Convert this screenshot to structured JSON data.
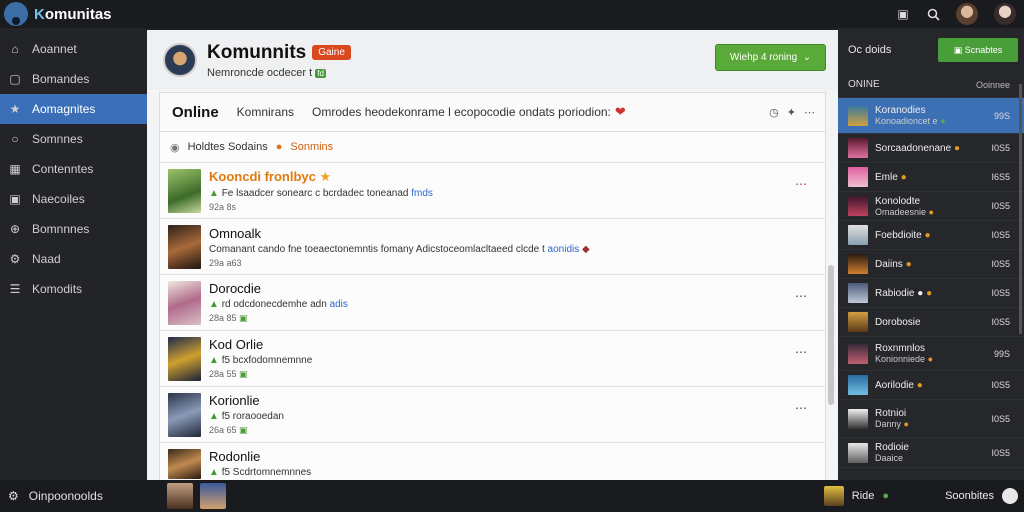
{
  "app": {
    "brand_prefix": "K",
    "brand_rest": "omunitas"
  },
  "colors": {
    "accent": "#3a6fb8",
    "join_green": "#5aaa3a",
    "badge_red": "#d9481f",
    "highlight_orange": "#e07a10"
  },
  "topbar": {
    "icons": [
      "window-icon",
      "search-icon"
    ]
  },
  "sidebar": {
    "items": [
      {
        "label": "Aoannet",
        "icon": "home-icon",
        "active": false
      },
      {
        "label": "Bomandes",
        "icon": "box-icon",
        "active": false
      },
      {
        "label": "Aomagnites",
        "icon": "star-icon",
        "active": true
      },
      {
        "label": "Somnnes",
        "icon": "chat-icon",
        "active": false
      },
      {
        "label": "Contenntes",
        "icon": "grid-icon",
        "active": false
      },
      {
        "label": "Naecoiles",
        "icon": "bookmark-icon",
        "active": false
      },
      {
        "label": "Bomnnnes",
        "icon": "globe-icon",
        "active": false
      },
      {
        "label": "Naad",
        "icon": "gear-icon",
        "active": false
      },
      {
        "label": "Komodits",
        "icon": "list-icon",
        "active": false
      }
    ]
  },
  "group": {
    "name": "Komunnits",
    "badge": "Gaine",
    "subtitle": "Nemroncde ocdecer t",
    "subtitle_tag": "fd",
    "join_label": "Wiehp 4 roning"
  },
  "tabs": {
    "active": "Online",
    "second": "Komnirans",
    "description": "Omrodes heodekonrame l ecopocodie ondats poriodion:"
  },
  "filters": {
    "left": "Holdtes Sodains",
    "right": "Sonmins"
  },
  "posts": [
    {
      "title": "Kooncdi fronlbyc",
      "line": "Fe lsaadcer sonearc c bcrdadec toneanad",
      "link": "fmds",
      "meta": "92a 8s"
    },
    {
      "title": "Omnoalk",
      "line": "Comanant cando fne toeaectonemntis fomany Adicstoceomlacltaeed clcde t",
      "link": "aonidis",
      "meta": "29a a63"
    },
    {
      "title": "Dorocdie",
      "line": "rd odcdonecdemhe adn",
      "link": "adis",
      "meta": "28a 85"
    },
    {
      "title": "Kod Orlie",
      "line": "f5 bcxfodomnemnne",
      "link": "",
      "meta": "28a 55"
    },
    {
      "title": "Korionlie",
      "line": "f5 roraooedan",
      "link": "",
      "meta": "26a 65"
    },
    {
      "title": "Rodonlie",
      "line": "f5 Scdrtomnemnnes",
      "link": "",
      "meta": ""
    }
  ],
  "right_panel": {
    "title": "Oc doids",
    "button": "Scnabtes",
    "section": "ONINE",
    "section_right": "Ooinnee",
    "items": [
      {
        "name": "Koranodies",
        "sub": "Konoadioncet e",
        "count": "99S"
      },
      {
        "name": "Sorcaadonenane",
        "sub": "",
        "count": "I0S5"
      },
      {
        "name": "Emle",
        "sub": "",
        "count": "I6S5"
      },
      {
        "name": "Konolodte",
        "sub": "Omadeesnie",
        "count": "I0S5"
      },
      {
        "name": "Foebdioite",
        "sub": "",
        "count": "I0S5"
      },
      {
        "name": "Daiins",
        "sub": "",
        "count": "I0S5"
      },
      {
        "name": "Rabiodie",
        "sub": "",
        "count": "I0S5"
      },
      {
        "name": "Dorobosie",
        "sub": "",
        "count": "I0S5"
      },
      {
        "name": "Roxnmnlos",
        "sub": "Konionniede",
        "count": "99S"
      },
      {
        "name": "Aorilodie",
        "sub": "",
        "count": "I0S5"
      },
      {
        "name": "Rotnioi",
        "sub": "Danny",
        "count": "I0S5"
      },
      {
        "name": "Rodioie",
        "sub": "Daaice",
        "count": "I0S5"
      },
      {
        "name": "Ride",
        "sub": "",
        "count": ""
      }
    ]
  },
  "bottombar": {
    "left_label": "Oinpoonoolds",
    "right_label": "Soonbites"
  }
}
